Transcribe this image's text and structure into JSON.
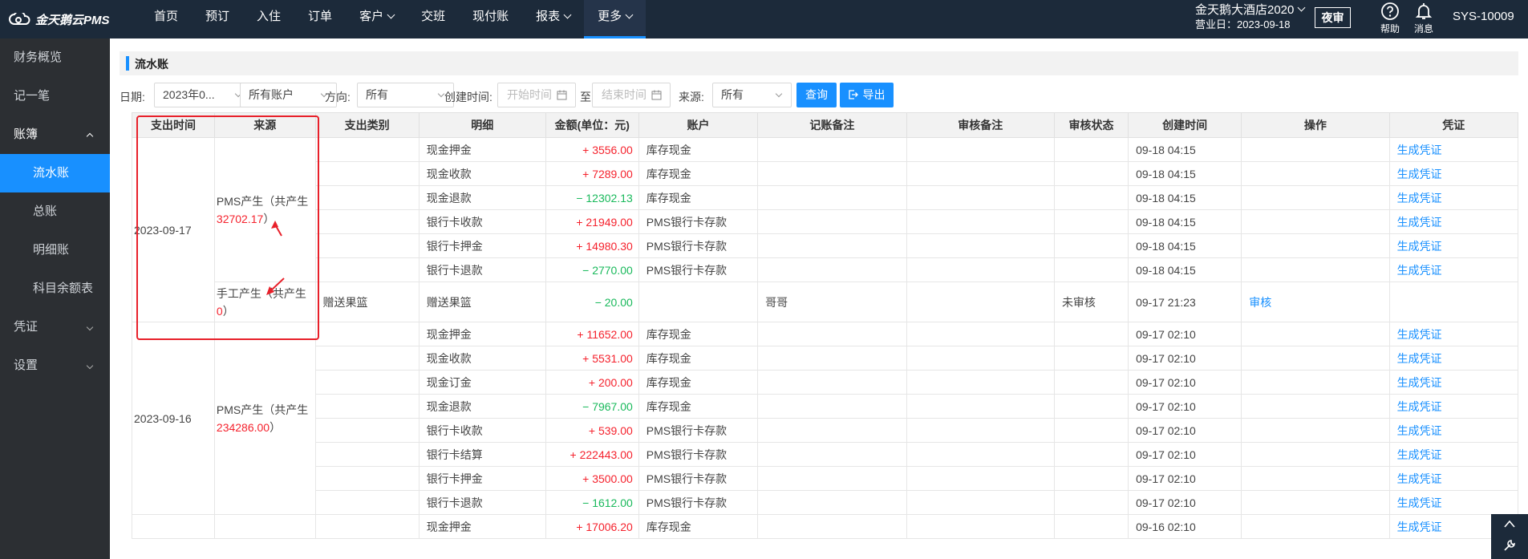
{
  "app": {
    "logo_text": "金天鹅云PMS"
  },
  "nav": {
    "items": [
      {
        "label": "首页",
        "has_menu": false
      },
      {
        "label": "预订",
        "has_menu": false
      },
      {
        "label": "入住",
        "has_menu": false
      },
      {
        "label": "订单",
        "has_menu": false
      },
      {
        "label": "客户",
        "has_menu": true
      },
      {
        "label": "交班",
        "has_menu": false
      },
      {
        "label": "现付账",
        "has_menu": false
      },
      {
        "label": "报表",
        "has_menu": true
      },
      {
        "label": "更多",
        "has_menu": true,
        "active": true
      }
    ],
    "hotel_name": "金天鹅大酒店2020",
    "business_date": "营业日：2023-09-18",
    "night_audit": "夜审",
    "help": "帮助",
    "messages": "消息",
    "user": "SYS-10009"
  },
  "sidebar": {
    "items": [
      {
        "label": "财务概览"
      },
      {
        "label": "记一笔"
      },
      {
        "label": "账簿",
        "expanded": true
      },
      {
        "label": "流水账",
        "sub": true,
        "active": true
      },
      {
        "label": "总账",
        "sub": true
      },
      {
        "label": "明细账",
        "sub": true
      },
      {
        "label": "科目余额表",
        "sub": true
      },
      {
        "label": "凭证",
        "collapsed": true
      },
      {
        "label": "设置",
        "collapsed": true
      }
    ]
  },
  "page": {
    "title": "流水账"
  },
  "filters": {
    "date_label": "日期:",
    "date_value": "2023年0...",
    "account_value": "所有账户",
    "direction_label": "方向:",
    "direction_value": "所有",
    "created_label": "创建时间:",
    "start_placeholder": "开始时间",
    "to_label": "至",
    "end_placeholder": "结束时间",
    "source_label": "来源:",
    "source_value": "所有",
    "query_button": "查询",
    "export_button": "导出"
  },
  "table": {
    "headers": [
      "支出时间",
      "来源",
      "支出类别",
      "明细",
      "金额(单位：元)",
      "账户",
      "记账备注",
      "审核备注",
      "审核状态",
      "创建时间",
      "操作",
      "凭证"
    ],
    "groups": [
      {
        "date": "2023-09-17",
        "sources": [
          {
            "prefix": "PMS产生（共产生",
            "amount": "32702.17",
            "suffix": "）",
            "rows": [
              {
                "category": "",
                "detail": "现金押金",
                "amount": "+ 3556.00",
                "sign": "pos",
                "account": "库存现金",
                "note": "",
                "audit_note": "",
                "status": "",
                "created": "09-18 04:15",
                "op": "",
                "voucher": "生成凭证"
              },
              {
                "category": "",
                "detail": "现金收款",
                "amount": "+ 7289.00",
                "sign": "pos",
                "account": "库存现金",
                "note": "",
                "audit_note": "",
                "status": "",
                "created": "09-18 04:15",
                "op": "",
                "voucher": "生成凭证"
              },
              {
                "category": "",
                "detail": "现金退款",
                "amount": "− 12302.13",
                "sign": "neg",
                "account": "库存现金",
                "note": "",
                "audit_note": "",
                "status": "",
                "created": "09-18 04:15",
                "op": "",
                "voucher": "生成凭证"
              },
              {
                "category": "",
                "detail": "银行卡收款",
                "amount": "+ 21949.00",
                "sign": "pos",
                "account": "PMS银行卡存款",
                "note": "",
                "audit_note": "",
                "status": "",
                "created": "09-18 04:15",
                "op": "",
                "voucher": "生成凭证"
              },
              {
                "category": "",
                "detail": "银行卡押金",
                "amount": "+ 14980.30",
                "sign": "pos",
                "account": "PMS银行卡存款",
                "note": "",
                "audit_note": "",
                "status": "",
                "created": "09-18 04:15",
                "op": "",
                "voucher": "生成凭证"
              },
              {
                "category": "",
                "detail": "银行卡退款",
                "amount": "− 2770.00",
                "sign": "neg",
                "account": "PMS银行卡存款",
                "note": "",
                "audit_note": "",
                "status": "",
                "created": "09-18 04:15",
                "op": "",
                "voucher": "生成凭证"
              }
            ]
          },
          {
            "prefix": "手工产生（共产生",
            "amount": "0",
            "suffix": "）",
            "rows": [
              {
                "category": "赠送果篮",
                "detail": "赠送果篮",
                "amount": "− 20.00",
                "sign": "neg",
                "account": "",
                "note": "哥哥",
                "audit_note": "",
                "status": "未审核",
                "created": "09-17 21:23",
                "op": "审核",
                "voucher": ""
              }
            ]
          }
        ]
      },
      {
        "date": "2023-09-16",
        "sources": [
          {
            "prefix": "PMS产生（共产生",
            "amount": "234286.00",
            "suffix": "）",
            "rows": [
              {
                "category": "",
                "detail": "现金押金",
                "amount": "+ 11652.00",
                "sign": "pos",
                "account": "库存现金",
                "note": "",
                "audit_note": "",
                "status": "",
                "created": "09-17 02:10",
                "op": "",
                "voucher": "生成凭证"
              },
              {
                "category": "",
                "detail": "现金收款",
                "amount": "+ 5531.00",
                "sign": "pos",
                "account": "库存现金",
                "note": "",
                "audit_note": "",
                "status": "",
                "created": "09-17 02:10",
                "op": "",
                "voucher": "生成凭证"
              },
              {
                "category": "",
                "detail": "现金订金",
                "amount": "+ 200.00",
                "sign": "pos",
                "account": "库存现金",
                "note": "",
                "audit_note": "",
                "status": "",
                "created": "09-17 02:10",
                "op": "",
                "voucher": "生成凭证"
              },
              {
                "category": "",
                "detail": "现金退款",
                "amount": "− 7967.00",
                "sign": "neg",
                "account": "库存现金",
                "note": "",
                "audit_note": "",
                "status": "",
                "created": "09-17 02:10",
                "op": "",
                "voucher": "生成凭证"
              },
              {
                "category": "",
                "detail": "银行卡收款",
                "amount": "+ 539.00",
                "sign": "pos",
                "account": "PMS银行卡存款",
                "note": "",
                "audit_note": "",
                "status": "",
                "created": "09-17 02:10",
                "op": "",
                "voucher": "生成凭证"
              },
              {
                "category": "",
                "detail": "银行卡结算",
                "amount": "+ 222443.00",
                "sign": "pos",
                "account": "PMS银行卡存款",
                "note": "",
                "audit_note": "",
                "status": "",
                "created": "09-17 02:10",
                "op": "",
                "voucher": "生成凭证"
              },
              {
                "category": "",
                "detail": "银行卡押金",
                "amount": "+ 3500.00",
                "sign": "pos",
                "account": "PMS银行卡存款",
                "note": "",
                "audit_note": "",
                "status": "",
                "created": "09-17 02:10",
                "op": "",
                "voucher": "生成凭证"
              },
              {
                "category": "",
                "detail": "银行卡退款",
                "amount": "− 1612.00",
                "sign": "neg",
                "account": "PMS银行卡存款",
                "note": "",
                "audit_note": "",
                "status": "",
                "created": "09-17 02:10",
                "op": "",
                "voucher": "生成凭证"
              }
            ]
          }
        ]
      },
      {
        "date": "",
        "sources": [
          {
            "prefix": "",
            "amount": "",
            "suffix": "",
            "rows": [
              {
                "category": "",
                "detail": "现金押金",
                "amount": "+ 17006.20",
                "sign": "pos",
                "account": "库存现金",
                "note": "",
                "audit_note": "",
                "status": "",
                "created": "09-16 02:10",
                "op": "",
                "voucher": "生成凭证"
              }
            ]
          }
        ]
      }
    ]
  },
  "colors": {
    "topbar": "#1c2a3a",
    "sidebar": "#2c2f33",
    "accent": "#1890ff",
    "positive": "#f5222d",
    "negative": "#19b95b",
    "annotation": "#e8202a"
  }
}
